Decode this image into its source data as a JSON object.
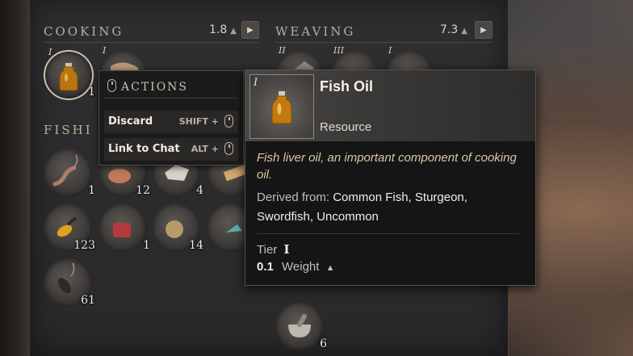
{
  "sections": {
    "cooking": {
      "title": "COOKING",
      "weight": "1.8"
    },
    "weaving": {
      "title": "WEAVING",
      "weight": "7.3"
    },
    "fishing": {
      "title": "FISHI"
    }
  },
  "slots": {
    "fish_oil": {
      "count": "1",
      "tier": "I"
    },
    "fish_1": {
      "count": "1"
    },
    "fish_2": {
      "count": "12"
    },
    "fish_3": {
      "count": "4"
    },
    "fish_5": {
      "count": "123"
    },
    "fish_6": {
      "count": "1"
    },
    "fish_7": {
      "count": "14"
    },
    "fish_9": {
      "count": "61"
    },
    "weave_1": {
      "tier": "II"
    },
    "weave_2": {
      "tier": "III"
    },
    "weave_3": {
      "tier": "I"
    },
    "mortar": {
      "count": "6"
    },
    "cook_2": {
      "tier": "I"
    }
  },
  "actions": {
    "title": "ACTIONS",
    "items": [
      {
        "label": "Discard",
        "key": "SHIFT +"
      },
      {
        "label": "Link to Chat",
        "key": "ALT +"
      }
    ]
  },
  "tooltip": {
    "tier_badge": "I",
    "name": "Fish Oil",
    "type": "Resource",
    "description": "Fish liver oil, an important component of cooking oil.",
    "derived_label": "Derived from:",
    "derived_from": "Common Fish, Sturgeon, Swordfish, Uncommon",
    "tier_label": "Tier",
    "tier_value": "I",
    "weight_value": "0.1",
    "weight_label": "Weight"
  },
  "icons": {
    "weight": "weight-icon",
    "arrow": "play-arrow-icon",
    "mouse": "mouse-icon"
  }
}
